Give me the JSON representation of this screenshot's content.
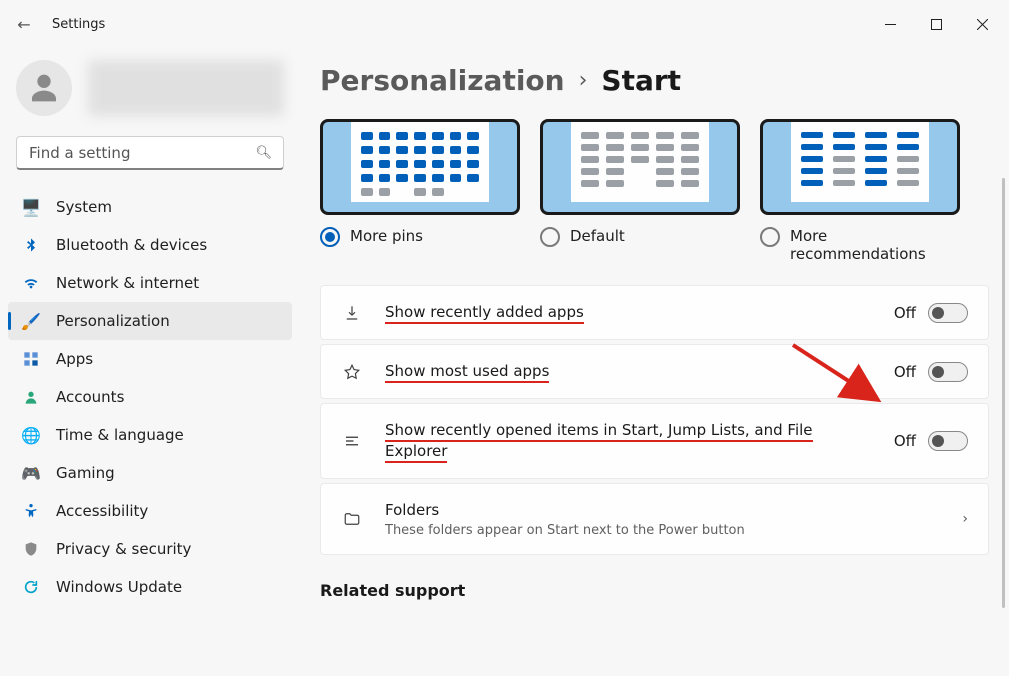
{
  "app_title": "Settings",
  "search": {
    "placeholder": "Find a setting"
  },
  "nav": {
    "system": "System",
    "bluetooth": "Bluetooth & devices",
    "network": "Network & internet",
    "personalization": "Personalization",
    "apps": "Apps",
    "accounts": "Accounts",
    "time": "Time & language",
    "gaming": "Gaming",
    "accessibility": "Accessibility",
    "privacy": "Privacy & security",
    "update": "Windows Update"
  },
  "breadcrumb": {
    "parent": "Personalization",
    "current": "Start"
  },
  "layouts": {
    "more_pins": "More pins",
    "default": "Default",
    "more_recs": "More recommendations",
    "selected": "more_pins"
  },
  "rows": {
    "recent_apps": {
      "label": "Show recently added apps",
      "state": "Off"
    },
    "most_used": {
      "label": "Show most used apps",
      "state": "Off"
    },
    "recent_items": {
      "label": "Show recently opened items in Start, Jump Lists, and File Explorer",
      "state": "Off"
    },
    "folders": {
      "label": "Folders",
      "sub": "These folders appear on Start next to the Power button"
    }
  },
  "related_support": "Related support"
}
